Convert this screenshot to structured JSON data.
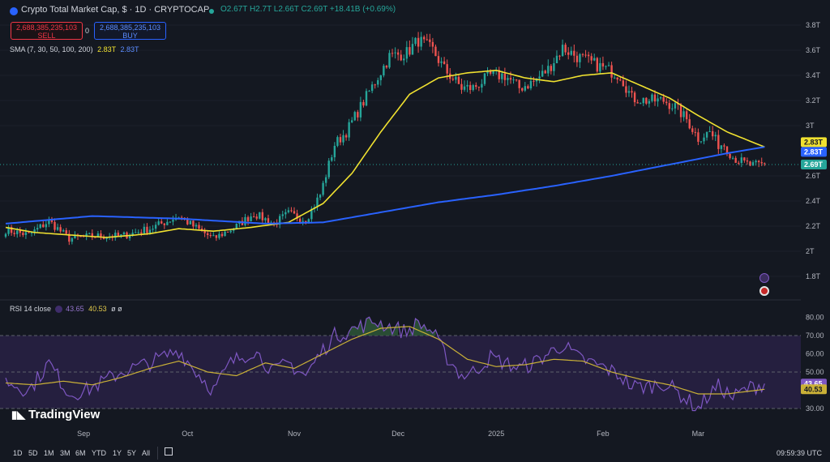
{
  "header": {
    "title": "Crypto Total Market Cap, $ · 1D · CRYPTOCAP",
    "ohlc": "O2.67T H2.7T L2.66T C2.69T +18.41B (+0.69%)",
    "sell_price": "2,688,385,235,103",
    "sell_label": "SELL",
    "buy_price": "2,688,385,235,103",
    "buy_label": "BUY",
    "spread": "0",
    "sma_label": "SMA (7, 30, 50, 100, 200)",
    "sma_val1": "2.83T",
    "sma_val2": "2.83T"
  },
  "rsi": {
    "label": "RSI 14 close",
    "val1": "43.65",
    "val2": "40.53",
    "extra": "ø ø"
  },
  "brand": {
    "name": "TradingView"
  },
  "toolbar": {
    "timeframes": [
      "1D",
      "5D",
      "1M",
      "3M",
      "6M",
      "YTD",
      "1Y",
      "5Y",
      "All"
    ],
    "clock": "09:59:39 UTC"
  },
  "colors": {
    "up": "#26a69a",
    "down": "#ef5350",
    "sma_fast": "#f0e130",
    "sma_slow": "#2962ff",
    "rsi_line": "#7e57c2",
    "rsi_ma": "#c9b037",
    "rsi_band": "#251f3f",
    "last_price": "#26a69a"
  },
  "chart_data": [
    {
      "type": "candlestick",
      "title": "Crypto Total Market Cap, $ · 1D · CRYPTOCAP",
      "x_ticks": [
        "Sep",
        "Oct",
        "Nov",
        "Dec",
        "2025",
        "Feb",
        "Mar"
      ],
      "y_ticks": [
        "1.8T",
        "2T",
        "2.2T",
        "2.4T",
        "2.6T",
        "3T",
        "3.2T",
        "3.4T",
        "3.6T",
        "3.8T"
      ],
      "ylim": [
        1.75,
        3.85
      ],
      "price_labels": {
        "sma_fast": "2.83T",
        "sma_slow": "2.83T",
        "last": "2.69T"
      },
      "anchors": [
        [
          0,
          2.17
        ],
        [
          8,
          2.13
        ],
        [
          15,
          2.24
        ],
        [
          22,
          2.1
        ],
        [
          30,
          2.12
        ],
        [
          40,
          2.12
        ],
        [
          50,
          2.18
        ],
        [
          60,
          2.28
        ],
        [
          65,
          2.2
        ],
        [
          72,
          2.1
        ],
        [
          80,
          2.2
        ],
        [
          86,
          2.3
        ],
        [
          93,
          2.22
        ],
        [
          98,
          2.3
        ],
        [
          104,
          2.25
        ],
        [
          109,
          2.45
        ],
        [
          114,
          2.85
        ],
        [
          118,
          2.95
        ],
        [
          123,
          3.15
        ],
        [
          128,
          3.35
        ],
        [
          133,
          3.55
        ],
        [
          139,
          3.58
        ],
        [
          143,
          3.68
        ],
        [
          148,
          3.6
        ],
        [
          152,
          3.45
        ],
        [
          158,
          3.3
        ],
        [
          162,
          3.3
        ],
        [
          168,
          3.4
        ],
        [
          173,
          3.4
        ],
        [
          178,
          3.3
        ],
        [
          183,
          3.35
        ],
        [
          188,
          3.45
        ],
        [
          193,
          3.62
        ],
        [
          198,
          3.55
        ],
        [
          203,
          3.5
        ],
        [
          208,
          3.45
        ],
        [
          213,
          3.4
        ],
        [
          217,
          3.22
        ],
        [
          222,
          3.2
        ],
        [
          228,
          3.2
        ],
        [
          232,
          3.15
        ],
        [
          236,
          3.05
        ],
        [
          240,
          2.9
        ],
        [
          244,
          2.95
        ],
        [
          247,
          2.85
        ],
        [
          249,
          2.85
        ],
        [
          252,
          2.75
        ],
        [
          256,
          2.7
        ],
        [
          259,
          2.68
        ],
        [
          263,
          2.69
        ]
      ],
      "sma_fast_anchors": [
        [
          0,
          2.19
        ],
        [
          10,
          2.15
        ],
        [
          22,
          2.13
        ],
        [
          35,
          2.11
        ],
        [
          50,
          2.14
        ],
        [
          60,
          2.18
        ],
        [
          72,
          2.16
        ],
        [
          85,
          2.19
        ],
        [
          98,
          2.23
        ],
        [
          110,
          2.38
        ],
        [
          120,
          2.62
        ],
        [
          130,
          2.95
        ],
        [
          140,
          3.25
        ],
        [
          150,
          3.38
        ],
        [
          160,
          3.42
        ],
        [
          170,
          3.44
        ],
        [
          180,
          3.38
        ],
        [
          190,
          3.35
        ],
        [
          200,
          3.4
        ],
        [
          210,
          3.42
        ],
        [
          220,
          3.32
        ],
        [
          230,
          3.22
        ],
        [
          240,
          3.08
        ],
        [
          250,
          2.95
        ],
        [
          263,
          2.83
        ]
      ],
      "sma_slow_anchors": [
        [
          0,
          2.22
        ],
        [
          30,
          2.28
        ],
        [
          60,
          2.26
        ],
        [
          90,
          2.22
        ],
        [
          110,
          2.23
        ],
        [
          130,
          2.31
        ],
        [
          150,
          2.39
        ],
        [
          170,
          2.45
        ],
        [
          190,
          2.52
        ],
        [
          210,
          2.6
        ],
        [
          230,
          2.69
        ],
        [
          250,
          2.78
        ],
        [
          263,
          2.83
        ]
      ]
    },
    {
      "type": "line",
      "title": "RSI 14 close",
      "y_ticks": [
        "30.00",
        "50.00",
        "60.00",
        "70.00",
        "80.00"
      ],
      "ylim": [
        27,
        84
      ],
      "band": [
        30,
        70
      ],
      "mid": 50,
      "last_values": [
        "43.65",
        "40.53"
      ],
      "rsi_anchors": [
        [
          0,
          45
        ],
        [
          8,
          40
        ],
        [
          15,
          55
        ],
        [
          22,
          38
        ],
        [
          28,
          40
        ],
        [
          33,
          44
        ],
        [
          40,
          50
        ],
        [
          50,
          55
        ],
        [
          60,
          62
        ],
        [
          65,
          52
        ],
        [
          72,
          40
        ],
        [
          78,
          55
        ],
        [
          86,
          62
        ],
        [
          93,
          50
        ],
        [
          98,
          55
        ],
        [
          104,
          48
        ],
        [
          109,
          60
        ],
        [
          114,
          70
        ],
        [
          118,
          72
        ],
        [
          123,
          75
        ],
        [
          128,
          78
        ],
        [
          133,
          75
        ],
        [
          139,
          72
        ],
        [
          143,
          77
        ],
        [
          148,
          72
        ],
        [
          152,
          60
        ],
        [
          158,
          48
        ],
        [
          162,
          50
        ],
        [
          168,
          58
        ],
        [
          173,
          55
        ],
        [
          178,
          52
        ],
        [
          183,
          55
        ],
        [
          188,
          60
        ],
        [
          193,
          65
        ],
        [
          198,
          58
        ],
        [
          203,
          55
        ],
        [
          208,
          52
        ],
        [
          213,
          48
        ],
        [
          217,
          42
        ],
        [
          222,
          42
        ],
        [
          228,
          44
        ],
        [
          232,
          40
        ],
        [
          236,
          35
        ],
        [
          240,
          30
        ],
        [
          244,
          38
        ],
        [
          247,
          42
        ],
        [
          249,
          40
        ],
        [
          252,
          36
        ],
        [
          256,
          40
        ],
        [
          259,
          42
        ],
        [
          263,
          43.65
        ]
      ],
      "rsi_ma_anchors": [
        [
          0,
          44
        ],
        [
          10,
          43
        ],
        [
          20,
          45
        ],
        [
          30,
          43
        ],
        [
          40,
          47
        ],
        [
          50,
          52
        ],
        [
          60,
          56
        ],
        [
          70,
          50
        ],
        [
          80,
          48
        ],
        [
          90,
          55
        ],
        [
          100,
          52
        ],
        [
          110,
          60
        ],
        [
          120,
          68
        ],
        [
          130,
          74
        ],
        [
          140,
          75
        ],
        [
          150,
          68
        ],
        [
          160,
          57
        ],
        [
          170,
          53
        ],
        [
          180,
          54
        ],
        [
          190,
          57
        ],
        [
          200,
          56
        ],
        [
          210,
          50
        ],
        [
          220,
          46
        ],
        [
          230,
          43
        ],
        [
          240,
          38
        ],
        [
          250,
          38
        ],
        [
          263,
          40.53
        ]
      ]
    }
  ]
}
